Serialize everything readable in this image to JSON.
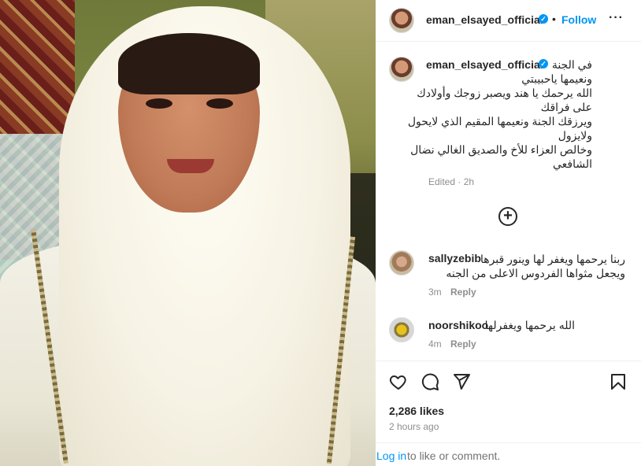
{
  "post": {
    "username": "eman_elsayed_official",
    "follow_label": "Follow",
    "separator": "•",
    "more_label": "···"
  },
  "caption": {
    "username": "eman_elsayed_official",
    "lines": [
      "في الجنة",
      "ونعيمها ياحبيبتي",
      "الله يرحمك يا هند ويصبر زوجك وأولادك",
      "على فراقك",
      "ويرزقك الجنة ونعيمها المقيم الذي لايحول",
      "ولايزول",
      "وخالص العزاء للأخ والصديق الغالي نضال",
      "الشافعي"
    ],
    "edited": "Edited · 2h"
  },
  "comments": [
    {
      "username": "sallyzebib",
      "lines": [
        "ربنا يرحمها ويغفر لها وينور قبرها",
        "ويجعل مثواها الفردوس الاعلى من الجنه"
      ],
      "time": "3m",
      "reply_label": "Reply"
    },
    {
      "username": "noorshikoo",
      "lines": [
        "الله يرحمها ويغفرلها"
      ],
      "time": "4m",
      "reply_label": "Reply"
    }
  ],
  "actions": {
    "likes": "2,286 likes",
    "time_ago": "2 hours ago"
  },
  "login": {
    "link_label": "Log in",
    "rest_text": "to like or comment."
  },
  "colors": {
    "accent": "#0095f6",
    "text": "#262626",
    "muted": "#8e8e8e"
  }
}
